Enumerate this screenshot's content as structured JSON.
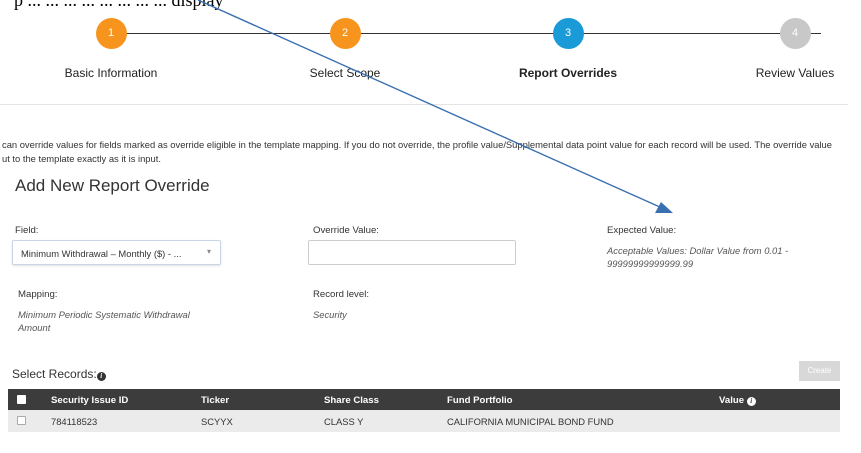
{
  "top_fragment": "p ... ... ... ... ... ... ... ... display",
  "stepper": {
    "steps": [
      {
        "number": "1",
        "label": "Basic Information",
        "color": "#f7941d",
        "active": false
      },
      {
        "number": "2",
        "label": "Select Scope",
        "color": "#f7941d",
        "active": false
      },
      {
        "number": "3",
        "label": "Report Overrides",
        "color": "#1a9ad6",
        "active": true
      },
      {
        "number": "4",
        "label": "Review Values",
        "color": "#c8c8c8",
        "active": false
      }
    ]
  },
  "info": {
    "line1": "can override values for fields marked as override eligible in the template mapping. If you do not override, the profile value/Supplemental data point value for each record will be used. The override value",
    "line2": "ut to the template exactly as it is input."
  },
  "form": {
    "title": "Add New Report Override",
    "field_label": "Field:",
    "field_value": "Minimum Withdrawal – Monthly ($) - ...",
    "override_label": "Override Value:",
    "override_value": "",
    "expected_label": "Expected Value:",
    "expected_value": "Acceptable Values: Dollar Value from 0.01 - 99999999999999.99",
    "mapping_label": "Mapping:",
    "mapping_value": "Minimum Periodic Systematic Withdrawal Amount",
    "record_level_label": "Record level:",
    "record_level_value": "Security"
  },
  "records": {
    "title": "Select Records:",
    "create_label": "Create",
    "columns": {
      "security_issue_id": "Security Issue ID",
      "ticker": "Ticker",
      "share_class": "Share Class",
      "fund_portfolio": "Fund Portfolio",
      "value": "Value"
    },
    "rows": [
      {
        "security_issue_id": "784118523",
        "ticker": "SCYYX",
        "share_class": "CLASS Y",
        "fund_portfolio": "CALIFORNIA MUNICIPAL BOND FUND"
      }
    ]
  },
  "colors": {
    "accent_orange": "#f7941d",
    "accent_blue": "#1a9ad6",
    "inactive_gray": "#c8c8c8",
    "table_header": "#3c3c3c",
    "annotation_arrow": "#3a6fb0"
  }
}
